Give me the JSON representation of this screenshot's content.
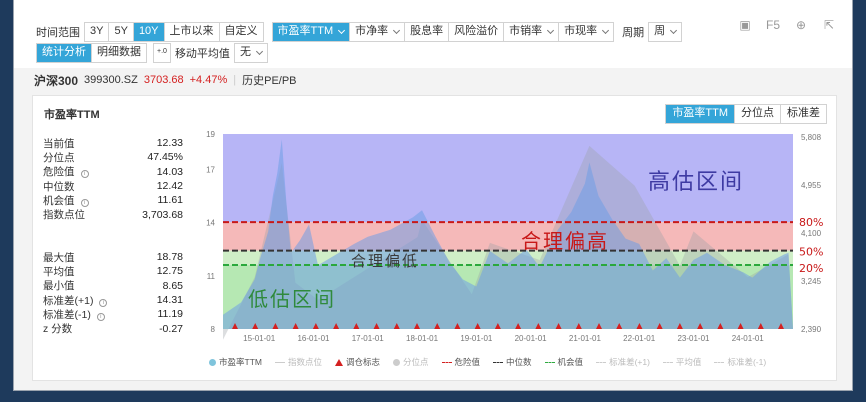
{
  "toolbar": {
    "period_label": "时间范围",
    "periods": [
      "3Y",
      "5Y",
      "10Y",
      "上市以来",
      "自定义"
    ],
    "active_period": "10Y",
    "metrics": [
      {
        "label": "市盈率TTM",
        "dropdown": true,
        "active": true
      },
      {
        "label": "市净率",
        "dropdown": true,
        "active": false
      },
      {
        "label": "股息率",
        "dropdown": false,
        "active": false
      },
      {
        "label": "风险溢价",
        "dropdown": false,
        "active": false
      },
      {
        "label": "市销率",
        "dropdown": true,
        "active": false
      },
      {
        "label": "市现率",
        "dropdown": true,
        "active": false
      }
    ],
    "cycle_label": "周期",
    "cycle_value": "周",
    "view_tabs": [
      "统计分析",
      "明细数据"
    ],
    "active_view": "统计分析",
    "ma_label": "移动平均值",
    "ma_value": "无",
    "f5_label": "F5"
  },
  "stock": {
    "name": "沪深300",
    "code": "399300.SZ",
    "price": "3703.68",
    "change": "+4.47%",
    "history_label": "历史PE/PB"
  },
  "panel": {
    "title": "市盈率TTM",
    "tabs": [
      "市盈率TTM",
      "分位点",
      "标准差"
    ],
    "active_tab": "市盈率TTM"
  },
  "stats_top": [
    {
      "label": "当前值",
      "value": "12.33",
      "info": false
    },
    {
      "label": "分位点",
      "value": "47.45%",
      "info": false
    },
    {
      "label": "危险值",
      "value": "14.03",
      "info": true
    },
    {
      "label": "中位数",
      "value": "12.42",
      "info": false
    },
    {
      "label": "机会值",
      "value": "11.61",
      "info": true
    },
    {
      "label": "指数点位",
      "value": "3,703.68",
      "info": false
    }
  ],
  "stats_bottom": [
    {
      "label": "最大值",
      "value": "18.78",
      "info": false
    },
    {
      "label": "平均值",
      "value": "12.75",
      "info": false
    },
    {
      "label": "最小值",
      "value": "8.65",
      "info": false
    },
    {
      "label": "标准差(+1)",
      "value": "14.31",
      "info": true
    },
    {
      "label": "标准差(-1)",
      "value": "11.19",
      "info": true
    },
    {
      "label": "z 分数",
      "value": "-0.27",
      "info": false
    }
  ],
  "chart_data": {
    "type": "area",
    "x_ticks": [
      "15-01-01",
      "16-01-01",
      "17-01-01",
      "18-01-01",
      "19-01-01",
      "20-01-01",
      "21-01-01",
      "22-01-01",
      "23-01-01",
      "24-01-01"
    ],
    "y_left_ticks": [
      8,
      11,
      14,
      17,
      19
    ],
    "y_left_range": [
      8,
      19
    ],
    "y_right_ticks": [
      "5,808",
      "4,955",
      "4,100",
      "3,245",
      "2,390"
    ],
    "pe_series": [
      {
        "x": "2014-05",
        "y": 8.8
      },
      {
        "x": "2014-09",
        "y": 9.5
      },
      {
        "x": "2014-12",
        "y": 10.8
      },
      {
        "x": "2015-01",
        "y": 11.8
      },
      {
        "x": "2015-03",
        "y": 13.5
      },
      {
        "x": "2015-04",
        "y": 15.5
      },
      {
        "x": "2015-05",
        "y": 16.8
      },
      {
        "x": "2015-06",
        "y": 18.7
      },
      {
        "x": "2015-07",
        "y": 15.2
      },
      {
        "x": "2015-08",
        "y": 12.3
      },
      {
        "x": "2015-10",
        "y": 13.0
      },
      {
        "x": "2015-12",
        "y": 13.9
      },
      {
        "x": "2016-02",
        "y": 11.6
      },
      {
        "x": "2016-06",
        "y": 12.2
      },
      {
        "x": "2016-10",
        "y": 12.8
      },
      {
        "x": "2017-01",
        "y": 13.2
      },
      {
        "x": "2017-06",
        "y": 13.6
      },
      {
        "x": "2017-11",
        "y": 14.3
      },
      {
        "x": "2018-01",
        "y": 14.7
      },
      {
        "x": "2018-04",
        "y": 13.2
      },
      {
        "x": "2018-07",
        "y": 11.8
      },
      {
        "x": "2018-10",
        "y": 10.8
      },
      {
        "x": "2019-01",
        "y": 10.4
      },
      {
        "x": "2019-04",
        "y": 12.4
      },
      {
        "x": "2019-08",
        "y": 11.7
      },
      {
        "x": "2019-12",
        "y": 12.5
      },
      {
        "x": "2020-03",
        "y": 11.5
      },
      {
        "x": "2020-07",
        "y": 13.6
      },
      {
        "x": "2020-10",
        "y": 14.6
      },
      {
        "x": "2021-01",
        "y": 16.2
      },
      {
        "x": "2021-02",
        "y": 17.4
      },
      {
        "x": "2021-04",
        "y": 15.5
      },
      {
        "x": "2021-07",
        "y": 14.2
      },
      {
        "x": "2021-10",
        "y": 13.1
      },
      {
        "x": "2022-01",
        "y": 12.8
      },
      {
        "x": "2022-04",
        "y": 11.3
      },
      {
        "x": "2022-07",
        "y": 12.0
      },
      {
        "x": "2022-10",
        "y": 10.9
      },
      {
        "x": "2023-01",
        "y": 11.9
      },
      {
        "x": "2023-04",
        "y": 12.3
      },
      {
        "x": "2023-08",
        "y": 11.6
      },
      {
        "x": "2023-12",
        "y": 11.2
      },
      {
        "x": "2024-02",
        "y": 10.9
      },
      {
        "x": "2024-06",
        "y": 11.8
      },
      {
        "x": "2024-09",
        "y": 12.2
      },
      {
        "x": "2024-10",
        "y": 12.3
      }
    ],
    "index_series": [
      {
        "x": "2014-05",
        "y": 2200
      },
      {
        "x": "2014-12",
        "y": 3300
      },
      {
        "x": "2015-06",
        "y": 5300
      },
      {
        "x": "2015-09",
        "y": 3200
      },
      {
        "x": "2016-02",
        "y": 2900
      },
      {
        "x": "2016-12",
        "y": 3400
      },
      {
        "x": "2017-12",
        "y": 4000
      },
      {
        "x": "2018-01",
        "y": 4300
      },
      {
        "x": "2018-12",
        "y": 3000
      },
      {
        "x": "2019-04",
        "y": 3900
      },
      {
        "x": "2020-03",
        "y": 3600
      },
      {
        "x": "2021-02",
        "y": 5600
      },
      {
        "x": "2021-12",
        "y": 4900
      },
      {
        "x": "2022-10",
        "y": 3500
      },
      {
        "x": "2023-01",
        "y": 4100
      },
      {
        "x": "2024-01",
        "y": 3300
      },
      {
        "x": "2024-10",
        "y": 3700
      }
    ],
    "danger_value": 14.03,
    "median_value": 12.42,
    "opportunity_value": 11.61,
    "adjustment_markers": 28,
    "zones": [
      {
        "label": "高估区间",
        "from": 14.03,
        "to": 19,
        "color": "#b7b5f6"
      },
      {
        "label": "合理偏高",
        "from": 12.42,
        "to": 14.03,
        "color": "#f5b9b9"
      },
      {
        "label": "合理偏低",
        "from": 11.61,
        "to": 12.42,
        "color": "#cfeec7"
      },
      {
        "label": "低估区间",
        "from": 8,
        "to": 11.61,
        "color": "#b6e8b3"
      }
    ],
    "annotations": [
      "80%",
      "50%",
      "20%"
    ],
    "legend": [
      {
        "label": "市盈率TTM",
        "color": "#7fc4dc",
        "symbol": "dot",
        "active": true
      },
      {
        "label": "指数点位",
        "color": "#cccccc",
        "symbol": "line",
        "active": false
      },
      {
        "label": "调仓标志",
        "color": "#d42020",
        "symbol": "triangle",
        "active": true
      },
      {
        "label": "分位点",
        "color": "#cccccc",
        "symbol": "dot",
        "active": false
      },
      {
        "label": "危险值",
        "color": "#d42020",
        "symbol": "dash",
        "active": true
      },
      {
        "label": "中位数",
        "color": "#333333",
        "symbol": "dash",
        "active": true
      },
      {
        "label": "机会值",
        "color": "#2faa40",
        "symbol": "dash",
        "active": true
      },
      {
        "label": "标准差(+1)",
        "color": "#cccccc",
        "symbol": "dash",
        "active": false
      },
      {
        "label": "平均值",
        "color": "#cccccc",
        "symbol": "dash",
        "active": false
      },
      {
        "label": "标准差(-1)",
        "color": "#cccccc",
        "symbol": "dash",
        "active": false
      }
    ]
  }
}
